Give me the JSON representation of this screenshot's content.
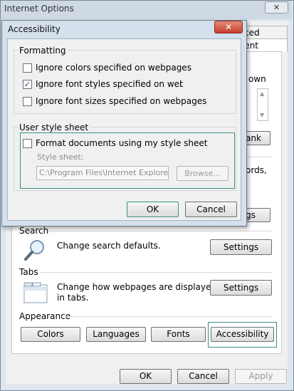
{
  "outer_window": {
    "title": "Internet Options",
    "close_glyph": "✕",
    "tabs_partial": [
      "ced",
      "ntent"
    ],
    "behind_dialog_fragments": {
      "text1": "own",
      "button1": "ank",
      "text2": "ords,",
      "button2": "gs"
    },
    "search": {
      "group_label": "Search",
      "description": "Change search defaults.",
      "button": "Settings",
      "icon": "magnifier-icon"
    },
    "tabs_section": {
      "group_label": "Tabs",
      "description_line1": "Change how webpages are displayed",
      "description_line2": "in tabs.",
      "button": "Settings",
      "icon": "tabbed-window-icon"
    },
    "appearance": {
      "group_label": "Appearance",
      "buttons": [
        "Colors",
        "Languages",
        "Fonts",
        "Accessibility"
      ]
    },
    "footer": {
      "ok": "OK",
      "cancel": "Cancel",
      "apply": "Apply"
    }
  },
  "dialog": {
    "title": "Accessibility",
    "close_glyph": "✕",
    "formatting": {
      "legend": "Formatting",
      "options": [
        {
          "label": "Ignore colors specified on webpages",
          "checked": false
        },
        {
          "label": "Ignore font styles specified on webpages",
          "checked": true
        },
        {
          "label": "Ignore font sizes specified on webpages",
          "checked": false
        }
      ]
    },
    "stylesheet": {
      "legend": "User style sheet",
      "checkbox_label": "Format documents using my style sheet",
      "checked": false,
      "field_label": "Style sheet:",
      "field_value": "C:\\Program Files\\Internet Explorer\\",
      "browse_button": "Browse..."
    },
    "ok": "OK",
    "cancel": "Cancel"
  },
  "colors": {
    "focus_border": "#3a8f8a",
    "checkmark": "#2a4c8a"
  }
}
